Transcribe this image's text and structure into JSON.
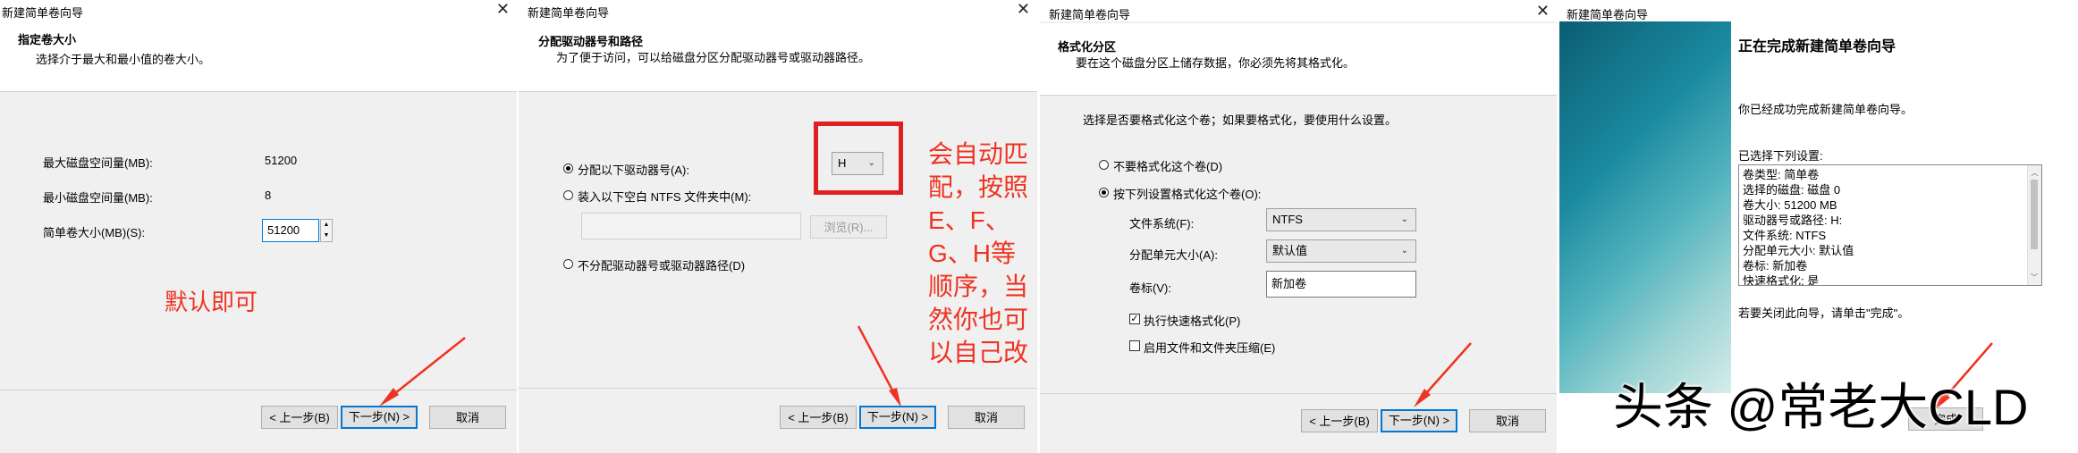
{
  "p1": {
    "title": "新建简单卷向导",
    "header_title": "指定卷大小",
    "header_sub": "选择介于最大和最小值的卷大小。",
    "rows": [
      {
        "label": "最大磁盘空间量(MB):",
        "value": "51200"
      },
      {
        "label": "最小磁盘空间量(MB):",
        "value": "8"
      }
    ],
    "size_label": "简单卷大小(MB)(S):",
    "size_value": "51200",
    "annotation": "默认即可",
    "back": "< 上一步(B)",
    "next": "下一步(N) >",
    "cancel": "取消"
  },
  "p2": {
    "title": "新建简单卷向导",
    "header_title": "分配驱动器号和路径",
    "header_sub": "为了便于访问，可以给磁盘分区分配驱动器号或驱动器路径。",
    "opt_assign": "分配以下驱动器号(A):",
    "drive_letter": "H",
    "opt_mount": "装入以下空白 NTFS 文件夹中(M):",
    "browse": "浏览(R)...",
    "opt_none": "不分配驱动器号或驱动器路径(D)",
    "annotation_lines": [
      "会自动匹",
      "配，按照",
      "E、F、",
      "G、H等",
      "顺序，当",
      "然你也可",
      "以自己改"
    ],
    "back": "< 上一步(B)",
    "next": "下一步(N) >",
    "cancel": "取消"
  },
  "p3": {
    "title": "新建简单卷向导",
    "header_title": "格式化分区",
    "header_sub": "要在这个磁盘分区上储存数据，你必须先将其格式化。",
    "question": "选择是否要格式化这个卷；如果要格式化，要使用什么设置。",
    "opt_noformat": "不要格式化这个卷(D)",
    "opt_format": "按下列设置格式化这个卷(O):",
    "fs_label": "文件系统(F):",
    "fs_value": "NTFS",
    "alloc_label": "分配单元大小(A):",
    "alloc_value": "默认值",
    "vol_label": "卷标(V):",
    "vol_value": "新加卷",
    "quick_format": "执行快速格式化(P)",
    "compress": "启用文件和文件夹压缩(E)",
    "back": "< 上一步(B)",
    "next": "下一步(N) >",
    "cancel": "取消"
  },
  "p4": {
    "title": "新建简单卷向导",
    "heading": "正在完成新建简单卷向导",
    "success": "你已经成功完成新建简单卷向导。",
    "selected_label": "已选择下列设置:",
    "summary": [
      "卷类型: 简单卷",
      "选择的磁盘: 磁盘 0",
      "卷大小: 51200 MB",
      "驱动器号或路径: H:",
      "文件系统: NTFS",
      "分配单元大小: 默认值",
      "卷标: 新加卷",
      "快速格式化: 是"
    ],
    "close_hint": "若要关闭此向导，请单击\"完成\"。",
    "finish_fragment": "完成",
    "watermark": "头条 @常老大CLD"
  },
  "colors": {
    "annotation_red": "#ee3322",
    "focus_blue": "#0078d7"
  }
}
